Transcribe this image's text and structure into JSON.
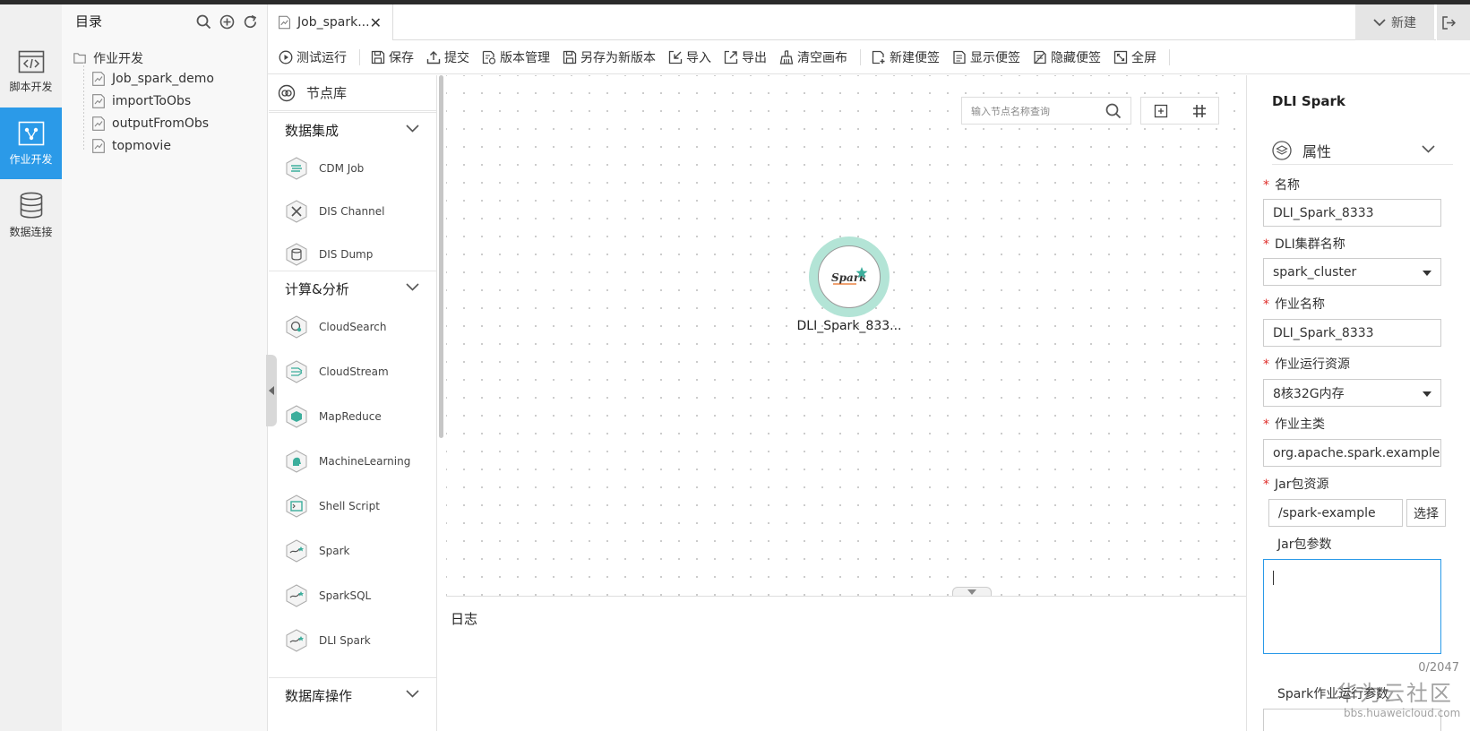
{
  "leftnav": {
    "items": [
      {
        "label": "脚本开发",
        "icon": "script-code-icon"
      },
      {
        "label": "作业开发",
        "icon": "job-flow-icon",
        "active": true
      },
      {
        "label": "数据连接",
        "icon": "database-icon"
      }
    ]
  },
  "tree": {
    "title": "目录",
    "root": "作业开发",
    "items": [
      "Job_spark_demo",
      "importToObs",
      "outputFromObs",
      "topmovie"
    ]
  },
  "tabs": {
    "active_tab": "Job_spark...",
    "new_label": "新建"
  },
  "toolbar": {
    "items": [
      "测试运行",
      "保存",
      "提交",
      "版本管理",
      "另存为新版本",
      "导入",
      "导出",
      "清空画布",
      "新建便签",
      "显示便签",
      "隐藏便签",
      "全屏"
    ]
  },
  "node_library": {
    "title": "节点库",
    "groups": [
      {
        "label": "数据集成",
        "items": [
          "CDM Job",
          "DIS Channel",
          "DIS Dump"
        ]
      },
      {
        "label": "计算&分析",
        "items": [
          "CloudSearch",
          "CloudStream",
          "MapReduce",
          "MachineLearning",
          "Shell Script",
          "Spark",
          "SparkSQL",
          "DLI Spark"
        ]
      },
      {
        "label": "数据库操作",
        "items": []
      }
    ]
  },
  "canvas": {
    "search_placeholder": "输入节点名称查询",
    "node": {
      "label": "DLI_Spark_833...",
      "logo_text": "Spark"
    }
  },
  "log": {
    "title": "日志"
  },
  "properties": {
    "title": "DLI Spark",
    "section": "属性",
    "fields": {
      "name": {
        "label": "名称",
        "value": "DLI_Spark_8333"
      },
      "cluster": {
        "label": "DLI集群名称",
        "value": "spark_cluster"
      },
      "job_name": {
        "label": "作业名称",
        "value": "DLI_Spark_8333"
      },
      "resource": {
        "label": "作业运行资源",
        "value": "8核32G内存"
      },
      "main_class": {
        "label": "作业主类",
        "value": "org.apache.spark.examples."
      },
      "jar": {
        "label": "Jar包资源",
        "value": "/spark-example",
        "button": "选择"
      },
      "jar_args": {
        "label": "Jar包参数",
        "counter": "0/2047"
      },
      "spark_args": {
        "label": "Spark作业运行参数"
      }
    }
  },
  "watermark": {
    "line1": "华为云社区",
    "line2": "bbs.huaweicloud.com"
  },
  "colors": {
    "accent": "#2b9ae8",
    "node_ring": "#b3e4d6",
    "required": "#e0302d"
  }
}
